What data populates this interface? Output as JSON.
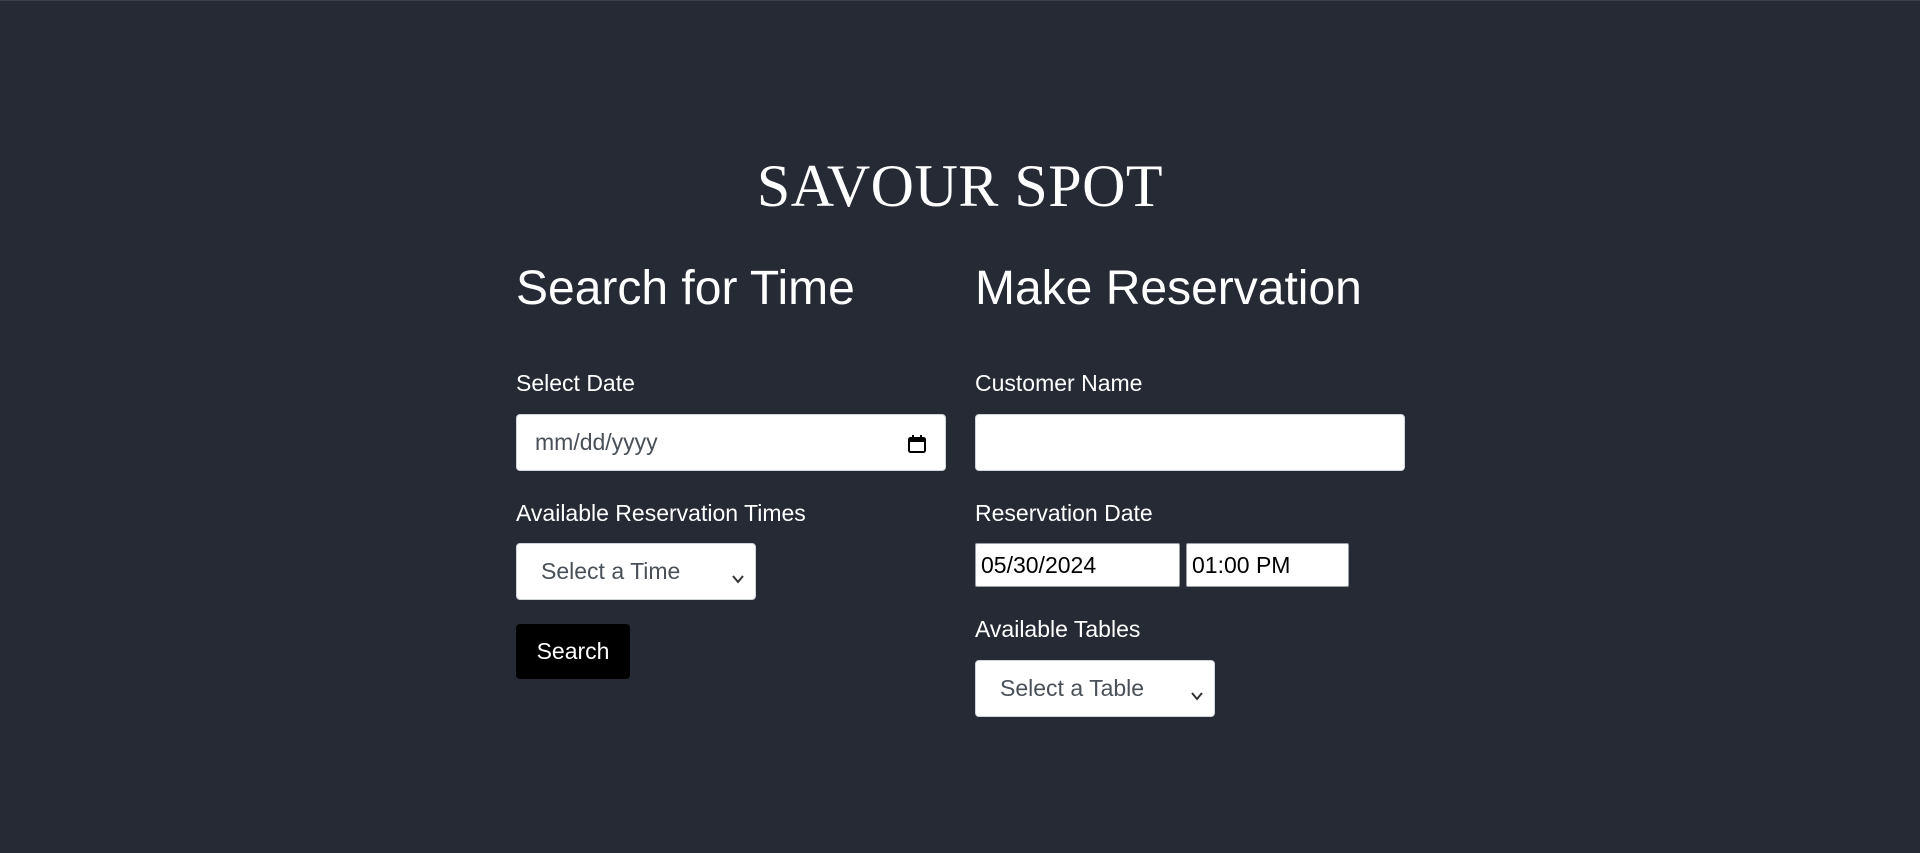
{
  "brand": {
    "title": "SAVOUR SPOT"
  },
  "search": {
    "heading": "Search for Time",
    "date_label": "Select Date",
    "date_placeholder": "mm/dd/yyyy",
    "times_label": "Available Reservation Times",
    "times_selected": "Select a Time",
    "button_label": "Search"
  },
  "reservation": {
    "heading": "Make Reservation",
    "name_label": "Customer Name",
    "name_value": "",
    "date_label": "Reservation Date",
    "date_value": "05/30/2024",
    "time_value": "01:00 PM",
    "tables_label": "Available Tables",
    "tables_selected": "Select a Table"
  },
  "icons": {
    "calendar": "calendar-icon",
    "chevron": "chevron-down-icon"
  },
  "colors": {
    "background": "#262a35",
    "text": "#ffffff",
    "button": "#000000"
  }
}
